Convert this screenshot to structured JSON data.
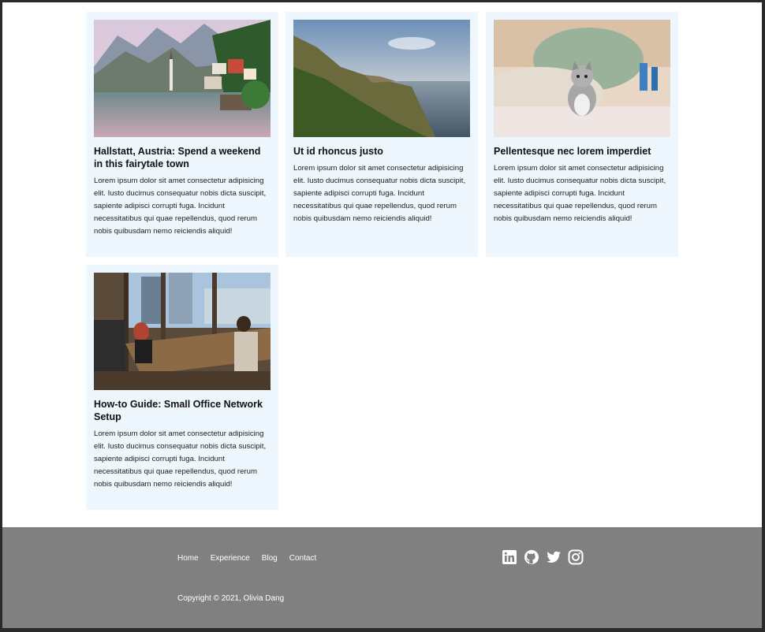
{
  "posts": [
    {
      "title": "Hallstatt, Austria: Spend a weekend in this fairytale town",
      "body": "Lorem ipsum dolor sit amet consectetur adipisicing elit. Iusto ducimus consequatur nobis dicta suscipit, sapiente adipisci corrupti fuga. Incidunt necessitatibus qui quae repellendus, quod rerum nobis quibusdam nemo reiciendis aliquid!"
    },
    {
      "title": "Ut id rhoncus justo",
      "body": "Lorem ipsum dolor sit amet consectetur adipisicing elit. Iusto ducimus consequatur nobis dicta suscipit, sapiente adipisci corrupti fuga. Incidunt necessitatibus qui quae repellendus, quod rerum nobis quibusdam nemo reiciendis aliquid!"
    },
    {
      "title": "Pellentesque nec lorem imperdiet",
      "body": "Lorem ipsum dolor sit amet consectetur adipisicing elit. Iusto ducimus consequatur nobis dicta suscipit, sapiente adipisci corrupti fuga. Incidunt necessitatibus qui quae repellendus, quod rerum nobis quibusdam nemo reiciendis aliquid!"
    },
    {
      "title": "How-to Guide: Small Office Network Setup",
      "body": "Lorem ipsum dolor sit amet consectetur adipisicing elit. Iusto ducimus consequatur nobis dicta suscipit, sapiente adipisci corrupti fuga. Incidunt necessitatibus qui quae repellendus, quod rerum nobis quibusdam nemo reiciendis aliquid!"
    }
  ],
  "footer": {
    "nav": [
      "Home",
      "Experience",
      "Blog",
      "Contact"
    ],
    "socials": [
      "linkedin-icon",
      "github-icon",
      "twitter-icon",
      "instagram-icon"
    ],
    "copyright": "Copyright © 2021, Olivia Dang"
  },
  "colors": {
    "card_bg": "#eef6fe",
    "footer_bg": "#808080"
  }
}
